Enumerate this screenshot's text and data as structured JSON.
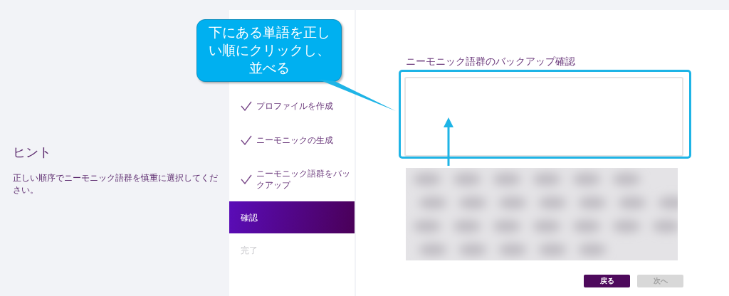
{
  "hint": {
    "title": "ヒント",
    "text": "正しい順序でニーモニック語群を慎重に選択してください。"
  },
  "steps": [
    {
      "label": "プロファイルを作成",
      "completed": true,
      "selected": false
    },
    {
      "label": "ニーモニックの生成",
      "completed": true,
      "selected": false
    },
    {
      "label": "ニーモニック語群をバックアップ",
      "completed": true,
      "selected": false
    },
    {
      "label": "確認",
      "completed": false,
      "selected": true
    },
    {
      "label": "完了",
      "completed": false,
      "selected": false
    }
  ],
  "main": {
    "title": "ニーモニック語群のバックアップ確認",
    "buttons": [
      {
        "label": "戻る",
        "disabled": false
      },
      {
        "label": "次へ",
        "disabled": true
      }
    ]
  },
  "annotation": {
    "text": "下にある単語を正しい順にクリックし、並べる"
  }
}
